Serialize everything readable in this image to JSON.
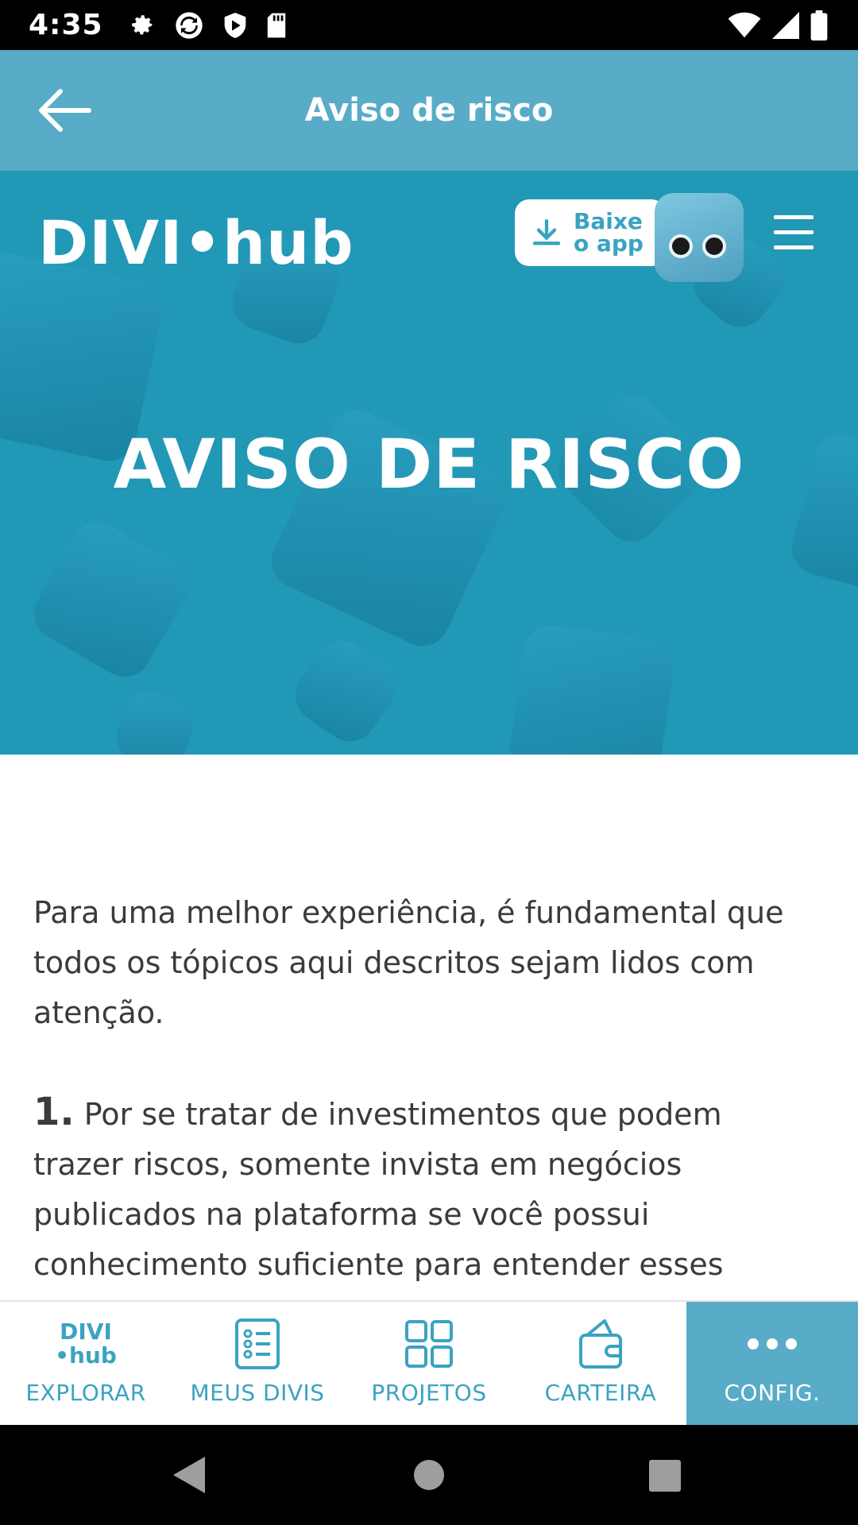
{
  "status_bar": {
    "time": "4:35",
    "icons": [
      "gear-icon",
      "sync-icon",
      "shield-icon",
      "sd-card-icon"
    ],
    "right_icons": [
      "wifi-icon",
      "signal-icon",
      "battery-icon"
    ]
  },
  "app_bar": {
    "title": "Aviso de risco",
    "back_icon": "arrow-left-icon"
  },
  "hero": {
    "logo": "DIVI•hub",
    "download_badge": "Baixe o app",
    "title": "AVISO DE RISCO"
  },
  "content": {
    "intro": "Para uma melhor experiência, é fundamental que todos os tópicos aqui descritos sejam lidos com atenção.",
    "item1_number": "1.",
    "item1_text": " Por se tratar de investimentos que podem trazer riscos, somente invista em negócios publicados na plataforma se você possui conhecimento suficiente para entender esses riscos e para tomar suas"
  },
  "bottom_nav": {
    "items": [
      {
        "label": "EXPLORAR",
        "icon": "divihub-logo-icon",
        "logo_top": "DIVI",
        "logo_bottom": "•hub"
      },
      {
        "label": "MEUS DIVIS",
        "icon": "list-icon"
      },
      {
        "label": "PROJETOS",
        "icon": "grid-icon"
      },
      {
        "label": "CARTEIRA",
        "icon": "wallet-icon"
      },
      {
        "label": "CONFIG.",
        "icon": "more-dots-icon"
      }
    ],
    "active_index": 4,
    "accent": "#58acc7"
  },
  "colors": {
    "app_bar": "#58acc7",
    "hero_bg": "#2198b5",
    "text": "#3b3b3b",
    "nav_accent": "#3aa3c2"
  }
}
